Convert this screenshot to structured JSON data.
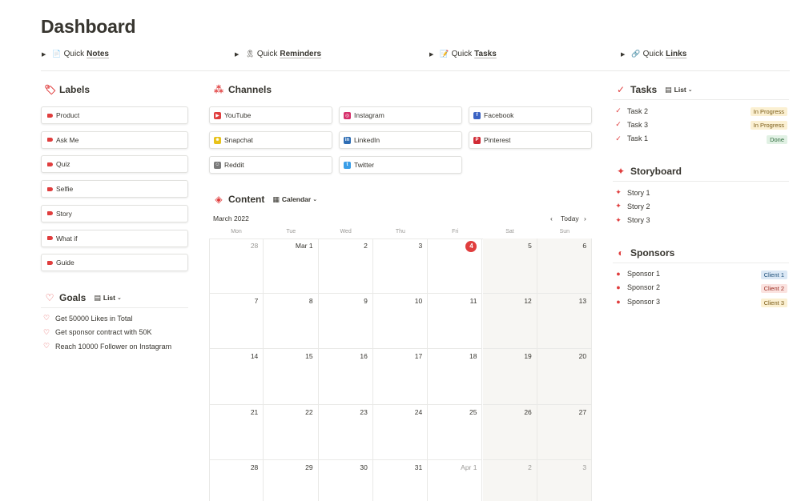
{
  "page": {
    "title": "Dashboard"
  },
  "quick": [
    {
      "icon": "📄",
      "prefix": "Quick",
      "bold": "Notes"
    },
    {
      "icon": "🎗",
      "prefix": "Quick",
      "bold": "Reminders"
    },
    {
      "icon": "📝",
      "prefix": "Quick",
      "bold": "Tasks"
    },
    {
      "icon": "🔗",
      "prefix": "Quick",
      "bold": "Links"
    }
  ],
  "labels": {
    "title": "Labels",
    "items": [
      "Product",
      "Ask Me",
      "Quiz",
      "Selfie",
      "Story",
      "What if",
      "Guide"
    ]
  },
  "goals": {
    "title": "Goals",
    "view": "List",
    "items": [
      "Get 50000 Likes in Total",
      "Get sponsor contract with 50K",
      "Reach 10000 Follower on Instagram"
    ]
  },
  "channels": {
    "title": "Channels",
    "items": [
      {
        "name": "YouTube",
        "icon": "youtube-icon",
        "color": "#e03e3e",
        "glyph": "▶"
      },
      {
        "name": "Instagram",
        "icon": "instagram-icon",
        "color": "#d6306b",
        "glyph": "◎"
      },
      {
        "name": "Facebook",
        "icon": "facebook-icon",
        "color": "#3b63c4",
        "glyph": "f"
      },
      {
        "name": "Snapchat",
        "icon": "snapchat-icon",
        "color": "#e8c21a",
        "glyph": "☻"
      },
      {
        "name": "LinkedIn",
        "icon": "linkedin-icon",
        "color": "#2e6db4",
        "glyph": "in"
      },
      {
        "name": "Pinterest",
        "icon": "pinterest-icon",
        "color": "#d12b35",
        "glyph": "P"
      },
      {
        "name": "Reddit",
        "icon": "reddit-icon",
        "color": "#7a7a7a",
        "glyph": "☺"
      },
      {
        "name": "Twitter",
        "icon": "twitter-icon",
        "color": "#3a9ee8",
        "glyph": "t"
      }
    ]
  },
  "content": {
    "title": "Content",
    "view": "Calendar",
    "month": "March 2022",
    "today_label": "Today",
    "weekdays": [
      "Mon",
      "Tue",
      "Wed",
      "Thu",
      "Fri",
      "Sat",
      "Sun"
    ],
    "today_index": 4,
    "days": [
      {
        "label": "28",
        "muted": true
      },
      {
        "label": "Mar 1"
      },
      {
        "label": "2"
      },
      {
        "label": "3"
      },
      {
        "label": "4"
      },
      {
        "label": "5"
      },
      {
        "label": "6"
      },
      {
        "label": "7"
      },
      {
        "label": "8"
      },
      {
        "label": "9"
      },
      {
        "label": "10"
      },
      {
        "label": "11"
      },
      {
        "label": "12"
      },
      {
        "label": "13"
      },
      {
        "label": "14"
      },
      {
        "label": "15"
      },
      {
        "label": "16"
      },
      {
        "label": "17"
      },
      {
        "label": "18"
      },
      {
        "label": "19"
      },
      {
        "label": "20"
      },
      {
        "label": "21"
      },
      {
        "label": "22"
      },
      {
        "label": "23"
      },
      {
        "label": "24"
      },
      {
        "label": "25"
      },
      {
        "label": "26"
      },
      {
        "label": "27"
      },
      {
        "label": "28"
      },
      {
        "label": "29"
      },
      {
        "label": "30"
      },
      {
        "label": "31"
      },
      {
        "label": "Apr 1",
        "muted": true
      },
      {
        "label": "2",
        "muted": true
      },
      {
        "label": "3",
        "muted": true
      }
    ]
  },
  "tasks": {
    "title": "Tasks",
    "view": "List",
    "items": [
      {
        "name": "Task 2",
        "status": "In Progress",
        "bg": "#fbf0d2",
        "fg": "#7a5b16"
      },
      {
        "name": "Task 3",
        "status": "In Progress",
        "bg": "#fbf0d2",
        "fg": "#7a5b16"
      },
      {
        "name": "Task 1",
        "status": "Done",
        "bg": "#e1f1e4",
        "fg": "#2e6b3c"
      }
    ]
  },
  "storyboard": {
    "title": "Storyboard",
    "items": [
      "Story 1",
      "Story 2",
      "Story 3"
    ]
  },
  "sponsors": {
    "title": "Sponsors",
    "items": [
      {
        "name": "Sponsor 1",
        "client": "Client 1",
        "bg": "#dbe8f5",
        "fg": "#22527a"
      },
      {
        "name": "Sponsor 2",
        "client": "Client 2",
        "bg": "#fbe3e0",
        "fg": "#9b2f25"
      },
      {
        "name": "Sponsor 3",
        "client": "Client 3",
        "bg": "#fbf0d2",
        "fg": "#7a5b16"
      }
    ]
  }
}
